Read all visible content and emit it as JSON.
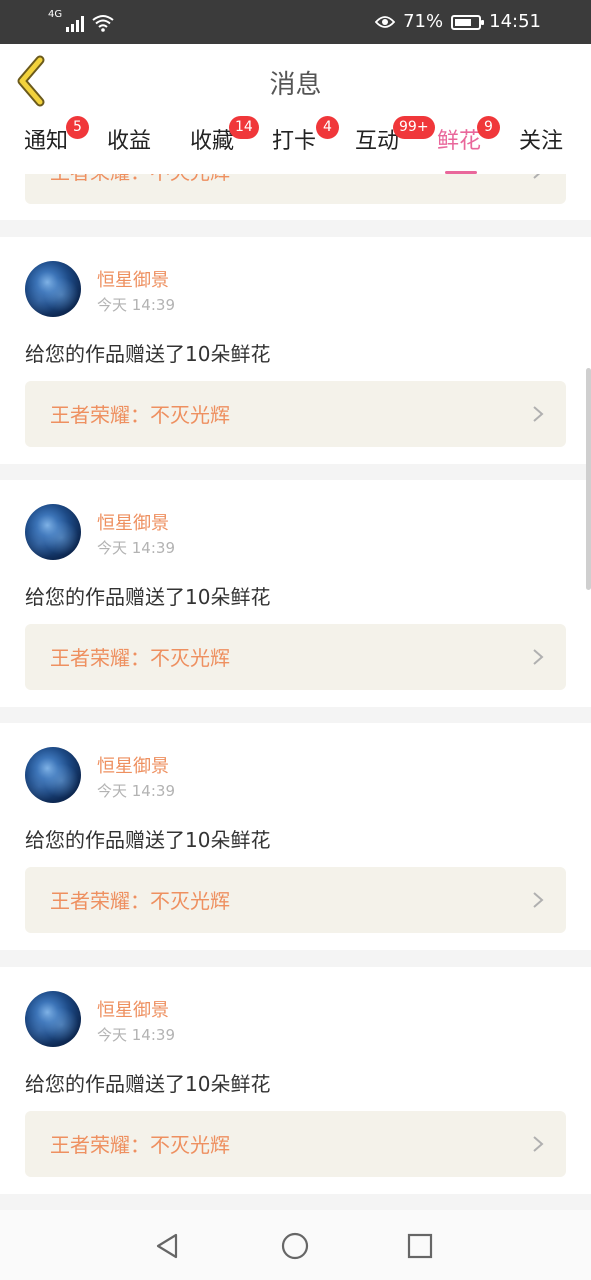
{
  "status_bar": {
    "network": "4G",
    "battery_percent": "71%",
    "battery_level": 0.71,
    "time": "14:51"
  },
  "header": {
    "title": "消息",
    "back_icon": "back-chevron-icon"
  },
  "tabs": [
    {
      "label": "通知",
      "badge": "5",
      "active": false
    },
    {
      "label": "收益",
      "badge": "",
      "active": false
    },
    {
      "label": "收藏",
      "badge": "14",
      "active": false
    },
    {
      "label": "打卡",
      "badge": "4",
      "active": false
    },
    {
      "label": "互动",
      "badge": "99+",
      "active": false
    },
    {
      "label": "鲜花",
      "badge": "9",
      "active": true
    },
    {
      "label": "关注",
      "badge": "",
      "active": false
    }
  ],
  "partial_item": {
    "link_text": "王者荣耀：不灭光辉"
  },
  "messages": [
    {
      "username": "恒星御景",
      "time": "今天 14:39",
      "text": "给您的作品赠送了10朵鲜花",
      "link_text": "王者荣耀：不灭光辉"
    },
    {
      "username": "恒星御景",
      "time": "今天 14:39",
      "text": "给您的作品赠送了10朵鲜花",
      "link_text": "王者荣耀：不灭光辉"
    },
    {
      "username": "恒星御景",
      "time": "今天 14:39",
      "text": "给您的作品赠送了10朵鲜花",
      "link_text": "王者荣耀：不灭光辉"
    },
    {
      "username": "恒星御景",
      "time": "今天 14:39",
      "text": "给您的作品赠送了10朵鲜花",
      "link_text": "王者荣耀：不灭光辉"
    }
  ],
  "colors": {
    "accent_pink": "#e9679b",
    "badge_red": "#f0373a",
    "name_orange": "#ee9060",
    "status_bar_bg": "#3b3b3b"
  },
  "nav_bar": {
    "icons": [
      "back-triangle-icon",
      "home-circle-icon",
      "recents-square-icon"
    ]
  }
}
